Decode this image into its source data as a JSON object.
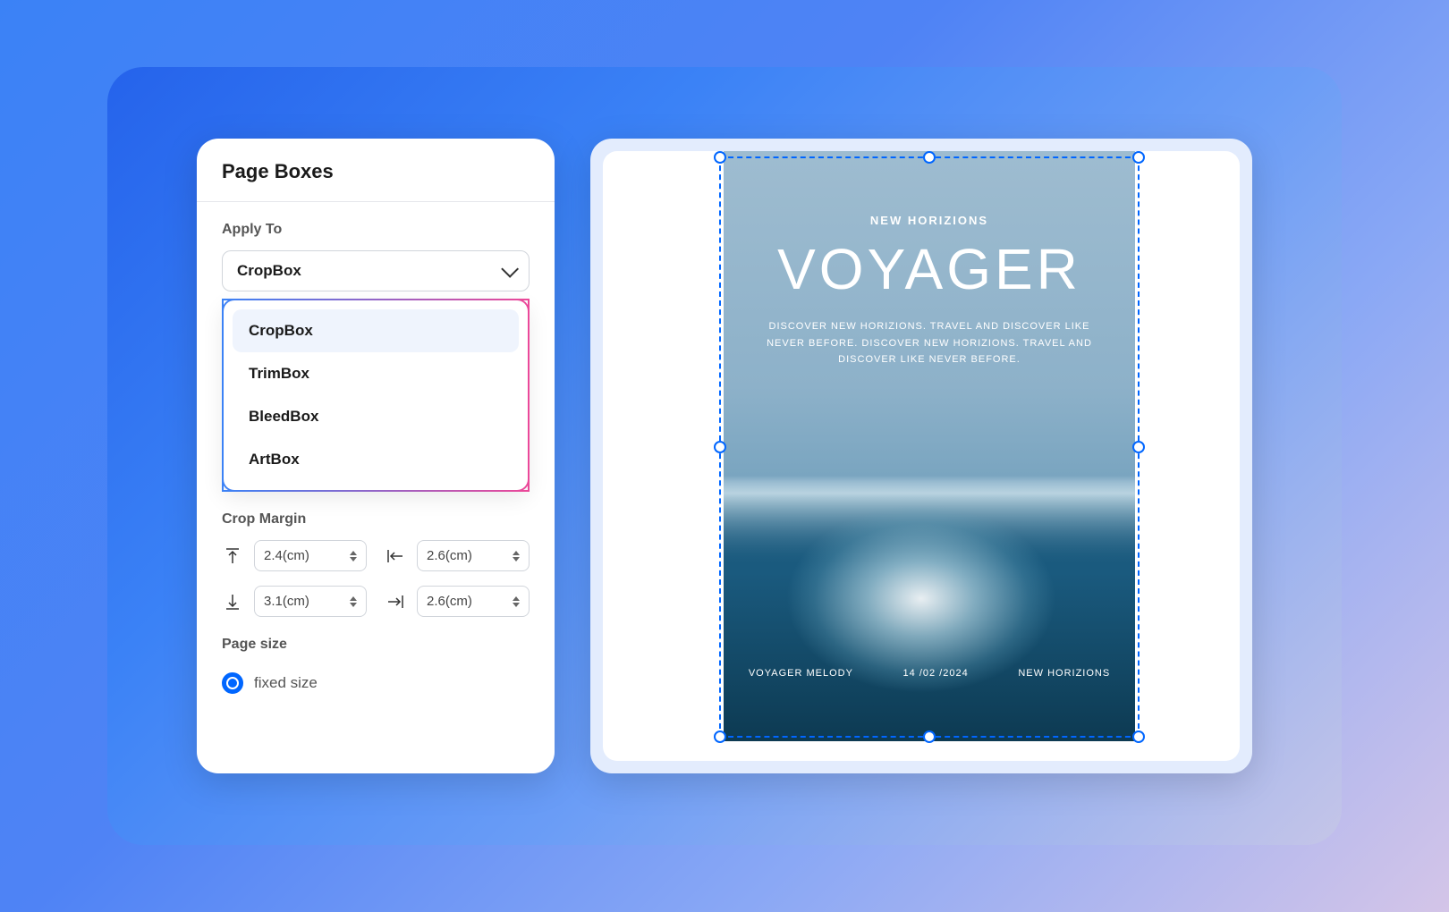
{
  "panel": {
    "title": "Page Boxes",
    "apply_to_label": "Apply To",
    "select_value": "CropBox",
    "dropdown": {
      "options": [
        "CropBox",
        "TrimBox",
        "BleedBox",
        "ArtBox"
      ]
    },
    "crop_margin_label": "Crop Margin",
    "margins": {
      "top": "2.4(cm)",
      "left": "2.6(cm)",
      "bottom": "3.1(cm)",
      "right": "2.6(cm)"
    },
    "page_size_label": "Page size",
    "fixed_size_label": "fixed size"
  },
  "document": {
    "subtitle": "NEW HORIZIONS",
    "title": "VOYAGER",
    "description": "DISCOVER NEW HORIZIONS. TRAVEL AND DISCOVER LIKE NEVER BEFORE. DISCOVER NEW HORIZIONS. TRAVEL AND DISCOVER LIKE NEVER BEFORE.",
    "footer_left": "VOYAGER MELODY",
    "footer_center": "14 /02 /2024",
    "footer_right": "NEW HORIZIONS"
  }
}
